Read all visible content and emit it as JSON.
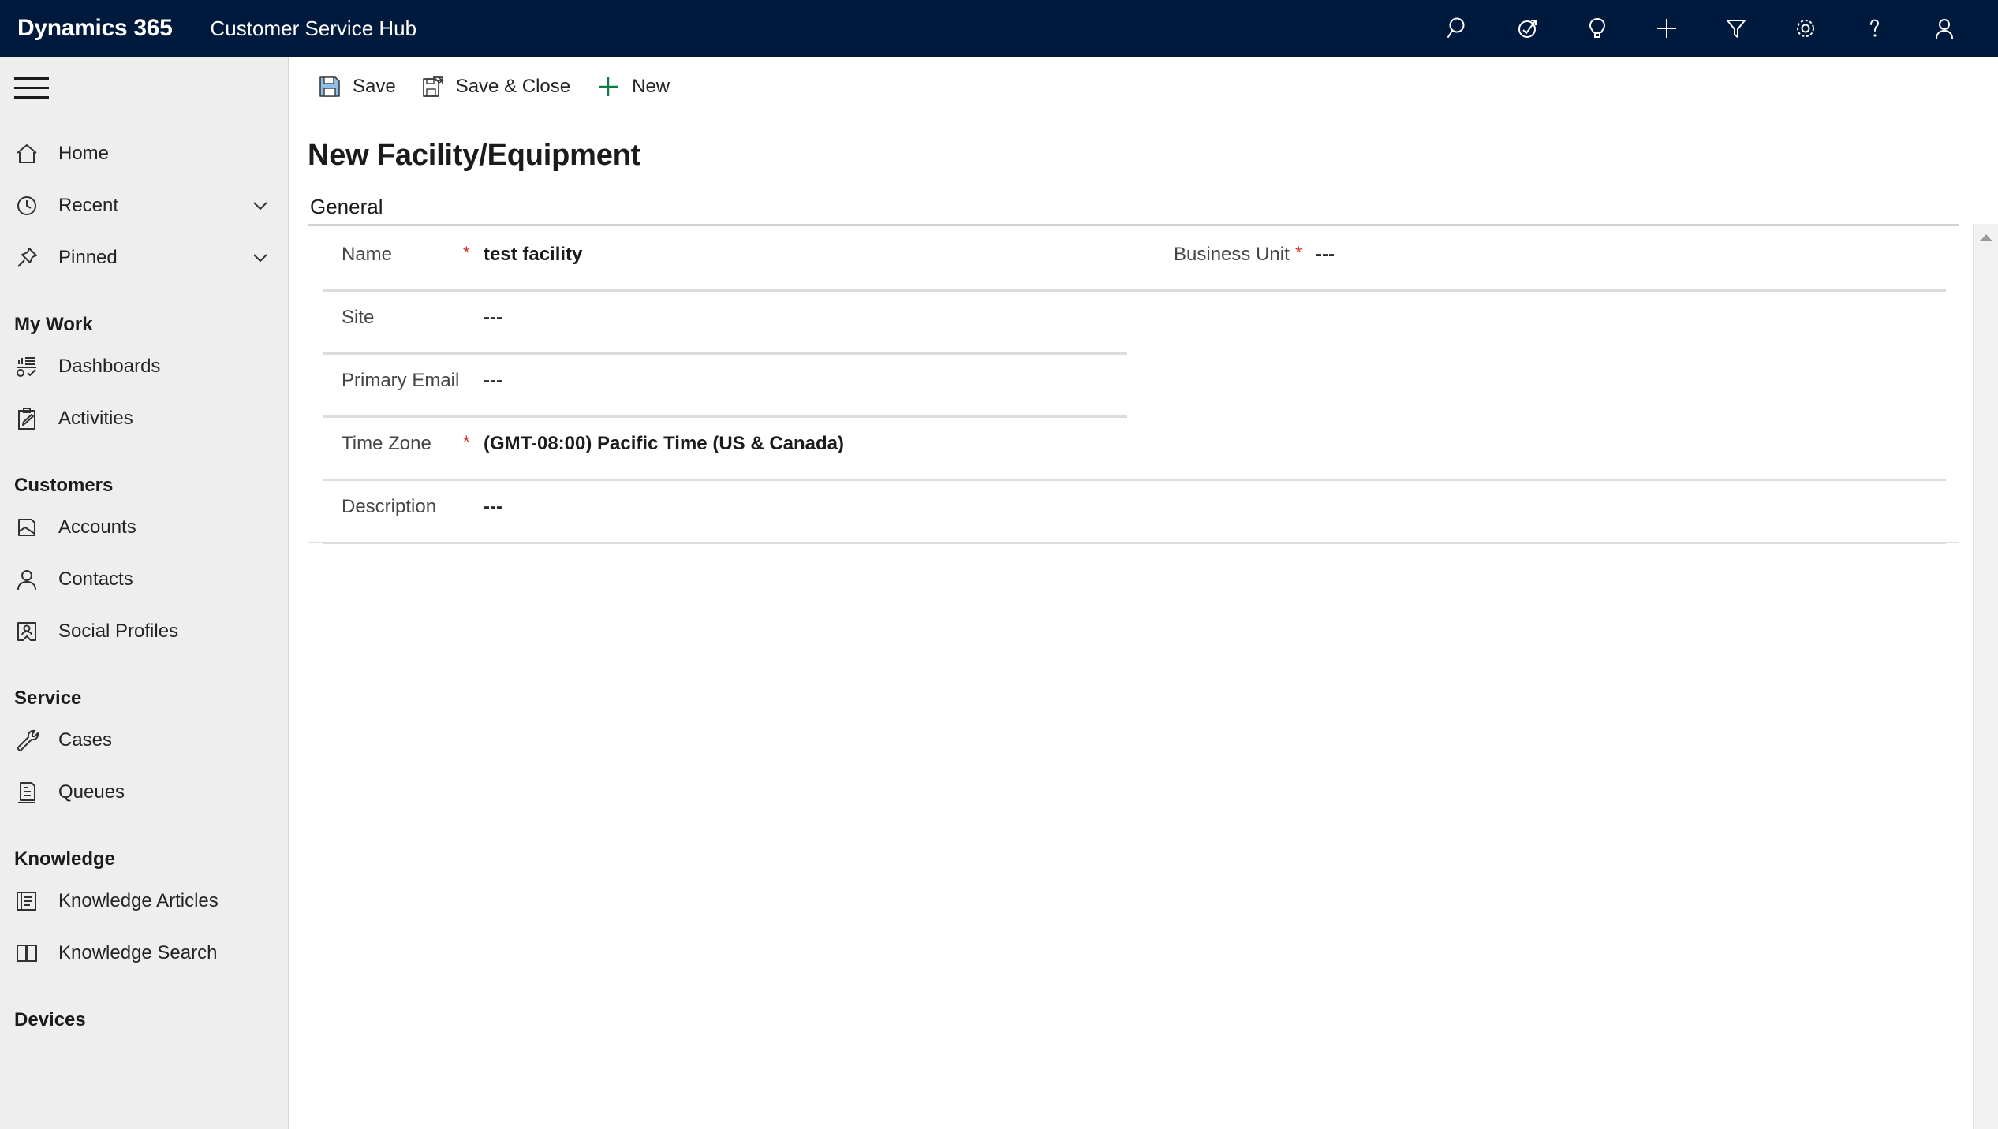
{
  "header": {
    "brand": "Dynamics 365",
    "app_name": "Customer Service Hub",
    "icons": [
      {
        "name": "search-icon",
        "label": "Search"
      },
      {
        "name": "assistant-icon",
        "label": "Assistant"
      },
      {
        "name": "lightbulb-icon",
        "label": "Insights"
      },
      {
        "name": "quick-create-icon",
        "label": "Quick Create"
      },
      {
        "name": "filter-icon",
        "label": "Filter"
      },
      {
        "name": "gear-icon",
        "label": "Settings"
      },
      {
        "name": "help-icon",
        "label": "Help"
      },
      {
        "name": "user-profile-icon",
        "label": "User"
      }
    ]
  },
  "sidebar": {
    "hamburger_label": "Site Map",
    "top_items": [
      {
        "label": "Home",
        "icon": "home-icon",
        "chevron": false
      },
      {
        "label": "Recent",
        "icon": "clock-icon",
        "chevron": true
      },
      {
        "label": "Pinned",
        "icon": "pin-icon",
        "chevron": true
      }
    ],
    "groups": [
      {
        "title": "My Work",
        "items": [
          {
            "label": "Dashboards",
            "icon": "dashboard-icon"
          },
          {
            "label": "Activities",
            "icon": "activities-icon"
          }
        ]
      },
      {
        "title": "Customers",
        "items": [
          {
            "label": "Accounts",
            "icon": "accounts-icon"
          },
          {
            "label": "Contacts",
            "icon": "contact-icon"
          },
          {
            "label": "Social Profiles",
            "icon": "social-profile-icon"
          }
        ]
      },
      {
        "title": "Service",
        "items": [
          {
            "label": "Cases",
            "icon": "wrench-icon"
          },
          {
            "label": "Queues",
            "icon": "queues-icon"
          }
        ]
      },
      {
        "title": "Knowledge",
        "items": [
          {
            "label": "Knowledge Articles",
            "icon": "article-icon"
          },
          {
            "label": "Knowledge Search",
            "icon": "book-icon"
          }
        ]
      },
      {
        "title": "Devices",
        "items": []
      }
    ]
  },
  "commandbar": {
    "save_label": "Save",
    "save_close_label": "Save & Close",
    "new_label": "New"
  },
  "page": {
    "title": "New Facility/Equipment",
    "tabs": [
      {
        "label": "General",
        "active": true
      }
    ]
  },
  "form": {
    "fields": {
      "name": {
        "label": "Name",
        "required": "*",
        "value": "test facility"
      },
      "business_unit": {
        "label": "Business Unit",
        "required": "*",
        "value": "---"
      },
      "site": {
        "label": "Site",
        "required": "",
        "value": "---"
      },
      "primary_email": {
        "label": "Primary Email",
        "required": "",
        "value": "---"
      },
      "time_zone": {
        "label": "Time Zone",
        "required": "*",
        "value": "(GMT-08:00) Pacific Time (US & Canada)"
      },
      "description": {
        "label": "Description",
        "required": "",
        "value": "---"
      }
    }
  },
  "colors": {
    "header_bg": "#001a3d",
    "sidebar_bg": "#eeeeee",
    "accent_blue": "#0b64e8",
    "required_red": "#d92b2b",
    "new_green": "#107c41",
    "save_blue": "#6ba8dc"
  }
}
